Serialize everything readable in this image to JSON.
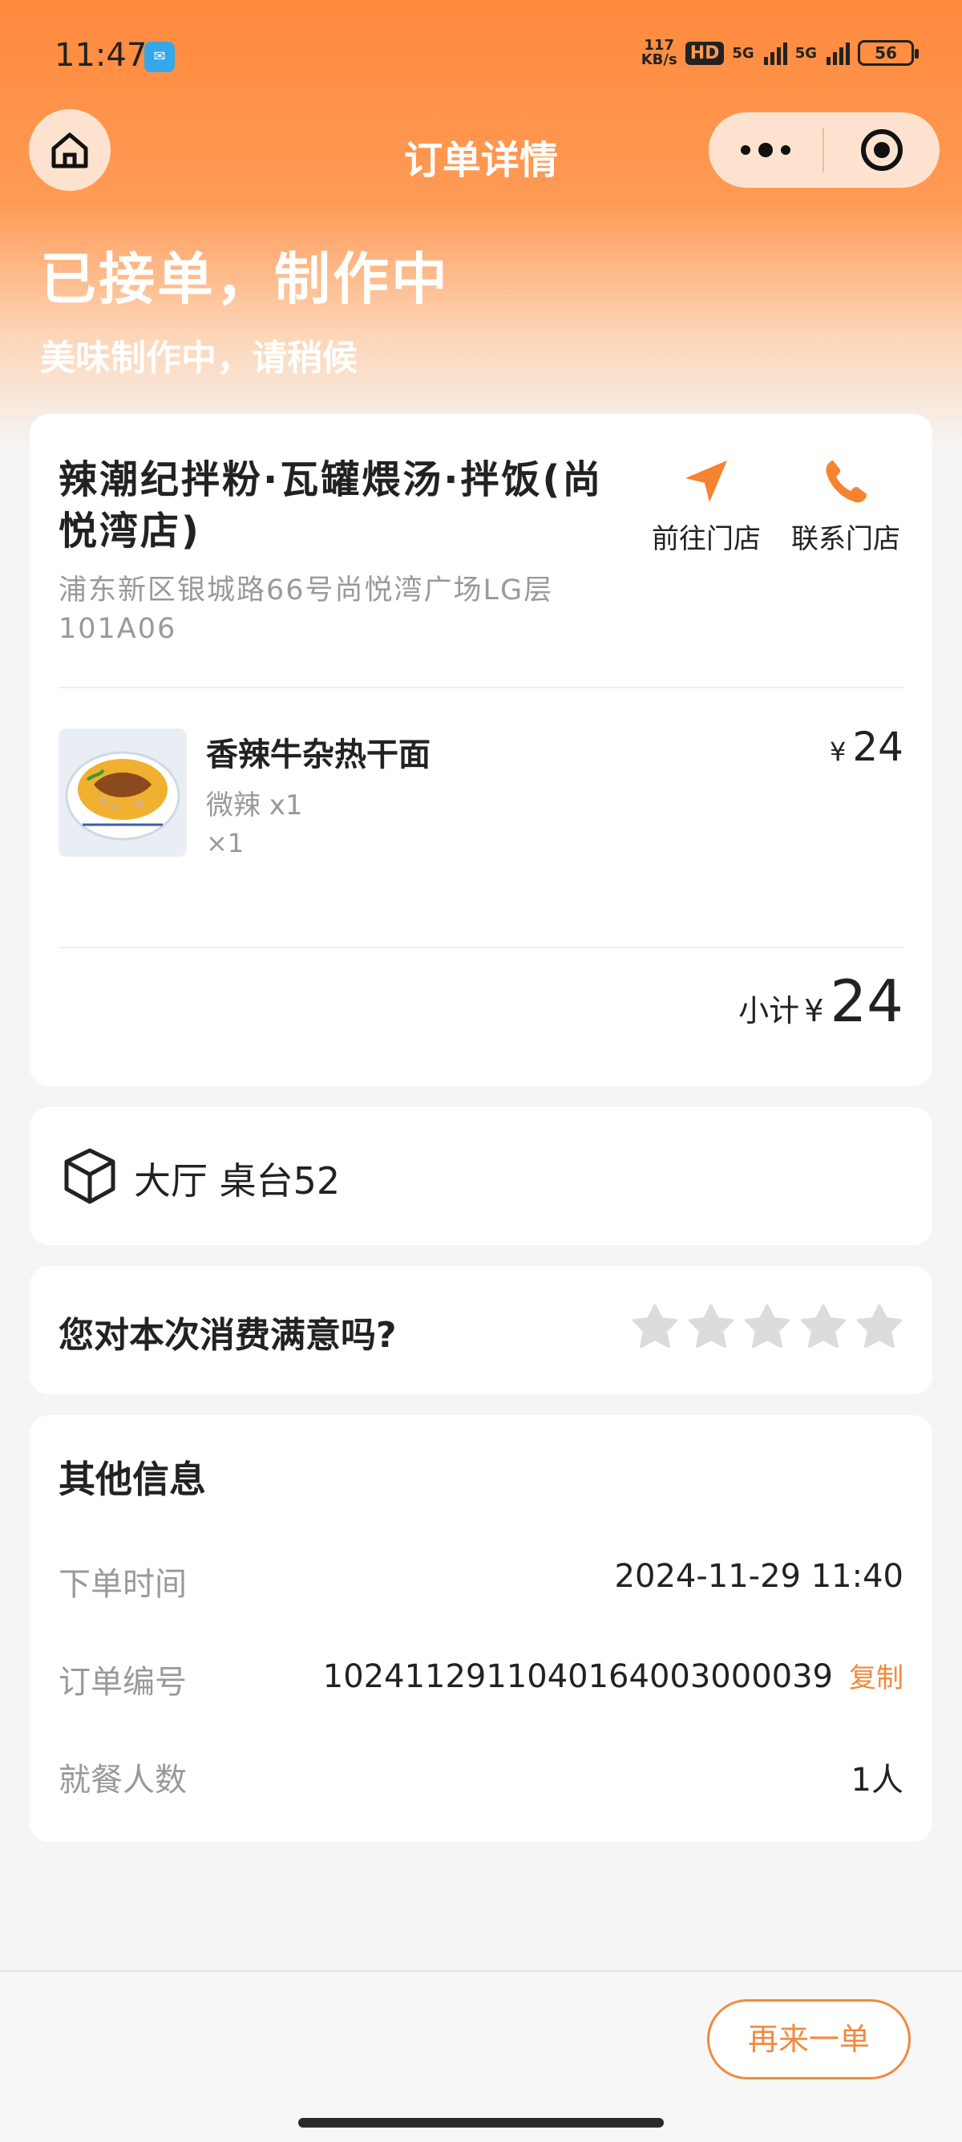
{
  "status_bar": {
    "time": "11:47",
    "net_speed_top": "117",
    "net_speed_bottom": "KB/s",
    "hd": "HD",
    "sig1": "5G",
    "sig2": "5G",
    "battery": "56"
  },
  "nav": {
    "title": "订单详情"
  },
  "order": {
    "status": "已接单，制作中",
    "sub": "美味制作中，请稍候"
  },
  "store": {
    "name": "辣潮纪拌粉·瓦罐煨汤·拌饭(尚悦湾店)",
    "address": "浦东新区银城路66号尚悦湾广场LG层101A06",
    "navigate_label": "前往门店",
    "contact_label": "联系门店"
  },
  "item": {
    "name": "香辣牛杂热干面",
    "spec": "微辣 x1",
    "qty": "×1",
    "currency": "¥",
    "price": "24"
  },
  "subtotal": {
    "label": "小计",
    "currency": "¥",
    "value": "24"
  },
  "table": {
    "text": "大厅 桌台52"
  },
  "rating": {
    "question": "您对本次消费满意吗?",
    "stars": 0,
    "max_stars": 5
  },
  "other": {
    "title": "其他信息",
    "order_time_label": "下单时间",
    "order_time_value": "2024-11-29 11:40",
    "order_no_label": "订单编号",
    "order_no_value": "1024112911040164003000039",
    "copy_label": "复制",
    "diners_label": "就餐人数",
    "diners_value": "1人"
  },
  "footer": {
    "reorder_label": "再来一单"
  },
  "colors": {
    "accent": "#f08a3e",
    "header": "#ff8a3d"
  }
}
